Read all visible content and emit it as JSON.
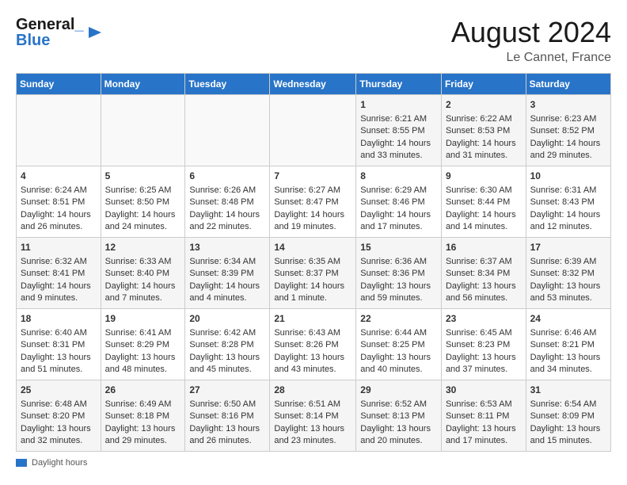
{
  "header": {
    "logo_line1": "General",
    "logo_line2": "Blue",
    "month_year": "August 2024",
    "location": "Le Cannet, France"
  },
  "columns": [
    "Sunday",
    "Monday",
    "Tuesday",
    "Wednesday",
    "Thursday",
    "Friday",
    "Saturday"
  ],
  "weeks": [
    [
      {
        "day": "",
        "text": ""
      },
      {
        "day": "",
        "text": ""
      },
      {
        "day": "",
        "text": ""
      },
      {
        "day": "",
        "text": ""
      },
      {
        "day": "1",
        "text": "Sunrise: 6:21 AM\nSunset: 8:55 PM\nDaylight: 14 hours and 33 minutes."
      },
      {
        "day": "2",
        "text": "Sunrise: 6:22 AM\nSunset: 8:53 PM\nDaylight: 14 hours and 31 minutes."
      },
      {
        "day": "3",
        "text": "Sunrise: 6:23 AM\nSunset: 8:52 PM\nDaylight: 14 hours and 29 minutes."
      }
    ],
    [
      {
        "day": "4",
        "text": "Sunrise: 6:24 AM\nSunset: 8:51 PM\nDaylight: 14 hours and 26 minutes."
      },
      {
        "day": "5",
        "text": "Sunrise: 6:25 AM\nSunset: 8:50 PM\nDaylight: 14 hours and 24 minutes."
      },
      {
        "day": "6",
        "text": "Sunrise: 6:26 AM\nSunset: 8:48 PM\nDaylight: 14 hours and 22 minutes."
      },
      {
        "day": "7",
        "text": "Sunrise: 6:27 AM\nSunset: 8:47 PM\nDaylight: 14 hours and 19 minutes."
      },
      {
        "day": "8",
        "text": "Sunrise: 6:29 AM\nSunset: 8:46 PM\nDaylight: 14 hours and 17 minutes."
      },
      {
        "day": "9",
        "text": "Sunrise: 6:30 AM\nSunset: 8:44 PM\nDaylight: 14 hours and 14 minutes."
      },
      {
        "day": "10",
        "text": "Sunrise: 6:31 AM\nSunset: 8:43 PM\nDaylight: 14 hours and 12 minutes."
      }
    ],
    [
      {
        "day": "11",
        "text": "Sunrise: 6:32 AM\nSunset: 8:41 PM\nDaylight: 14 hours and 9 minutes."
      },
      {
        "day": "12",
        "text": "Sunrise: 6:33 AM\nSunset: 8:40 PM\nDaylight: 14 hours and 7 minutes."
      },
      {
        "day": "13",
        "text": "Sunrise: 6:34 AM\nSunset: 8:39 PM\nDaylight: 14 hours and 4 minutes."
      },
      {
        "day": "14",
        "text": "Sunrise: 6:35 AM\nSunset: 8:37 PM\nDaylight: 14 hours and 1 minute."
      },
      {
        "day": "15",
        "text": "Sunrise: 6:36 AM\nSunset: 8:36 PM\nDaylight: 13 hours and 59 minutes."
      },
      {
        "day": "16",
        "text": "Sunrise: 6:37 AM\nSunset: 8:34 PM\nDaylight: 13 hours and 56 minutes."
      },
      {
        "day": "17",
        "text": "Sunrise: 6:39 AM\nSunset: 8:32 PM\nDaylight: 13 hours and 53 minutes."
      }
    ],
    [
      {
        "day": "18",
        "text": "Sunrise: 6:40 AM\nSunset: 8:31 PM\nDaylight: 13 hours and 51 minutes."
      },
      {
        "day": "19",
        "text": "Sunrise: 6:41 AM\nSunset: 8:29 PM\nDaylight: 13 hours and 48 minutes."
      },
      {
        "day": "20",
        "text": "Sunrise: 6:42 AM\nSunset: 8:28 PM\nDaylight: 13 hours and 45 minutes."
      },
      {
        "day": "21",
        "text": "Sunrise: 6:43 AM\nSunset: 8:26 PM\nDaylight: 13 hours and 43 minutes."
      },
      {
        "day": "22",
        "text": "Sunrise: 6:44 AM\nSunset: 8:25 PM\nDaylight: 13 hours and 40 minutes."
      },
      {
        "day": "23",
        "text": "Sunrise: 6:45 AM\nSunset: 8:23 PM\nDaylight: 13 hours and 37 minutes."
      },
      {
        "day": "24",
        "text": "Sunrise: 6:46 AM\nSunset: 8:21 PM\nDaylight: 13 hours and 34 minutes."
      }
    ],
    [
      {
        "day": "25",
        "text": "Sunrise: 6:48 AM\nSunset: 8:20 PM\nDaylight: 13 hours and 32 minutes."
      },
      {
        "day": "26",
        "text": "Sunrise: 6:49 AM\nSunset: 8:18 PM\nDaylight: 13 hours and 29 minutes."
      },
      {
        "day": "27",
        "text": "Sunrise: 6:50 AM\nSunset: 8:16 PM\nDaylight: 13 hours and 26 minutes."
      },
      {
        "day": "28",
        "text": "Sunrise: 6:51 AM\nSunset: 8:14 PM\nDaylight: 13 hours and 23 minutes."
      },
      {
        "day": "29",
        "text": "Sunrise: 6:52 AM\nSunset: 8:13 PM\nDaylight: 13 hours and 20 minutes."
      },
      {
        "day": "30",
        "text": "Sunrise: 6:53 AM\nSunset: 8:11 PM\nDaylight: 13 hours and 17 minutes."
      },
      {
        "day": "31",
        "text": "Sunrise: 6:54 AM\nSunset: 8:09 PM\nDaylight: 13 hours and 15 minutes."
      }
    ]
  ],
  "legend": {
    "label": "Daylight hours"
  }
}
